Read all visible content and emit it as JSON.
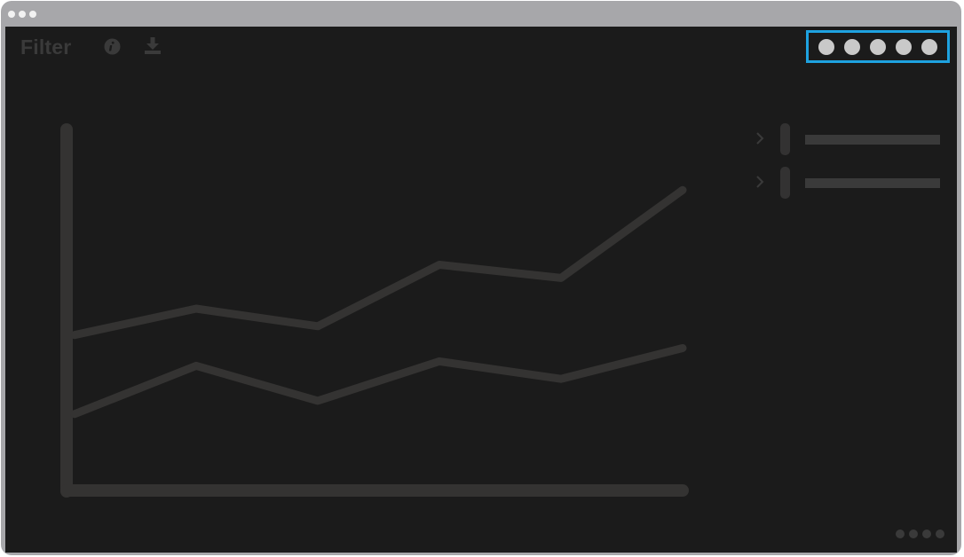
{
  "window": {
    "controls": [
      "window-dot",
      "window-dot",
      "window-dot"
    ]
  },
  "toolbar": {
    "filter_label": "Filter",
    "icons": [
      "info-icon",
      "download-icon"
    ]
  },
  "pagination": {
    "dots": 5,
    "highlight_color": "#1ea2e0"
  },
  "chart_data": {
    "type": "line",
    "x": [
      1,
      2,
      3,
      4,
      5,
      6
    ],
    "series": [
      {
        "values": [
          3.4,
          4.0,
          3.6,
          5.0,
          4.7,
          6.7
        ]
      },
      {
        "values": [
          1.6,
          2.7,
          1.9,
          2.8,
          2.4,
          3.1
        ]
      }
    ],
    "ylim": [
      0,
      8
    ],
    "grid": false,
    "colors": [
      "#343332",
      "#343332"
    ]
  },
  "legend": {
    "items": [
      {
        "icon": "chevron-right-icon"
      },
      {
        "icon": "chevron-right-icon"
      }
    ]
  },
  "footer": {
    "dots": 4
  }
}
